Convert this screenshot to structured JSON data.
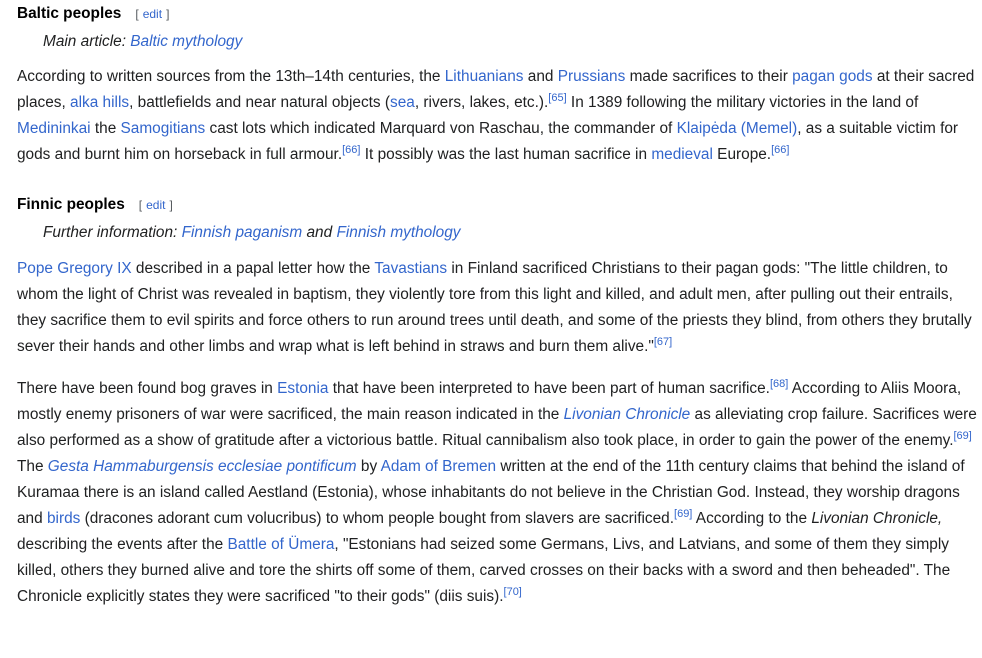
{
  "baltic": {
    "heading": "Baltic peoples",
    "edit_open": "[",
    "edit_label": "edit",
    "edit_close": "]",
    "hatnote_prefix": "Main article: ",
    "hatnote_link": "Baltic mythology",
    "p": [
      "According to written sources from the 13th–14th centuries, the ",
      "Lithuanians",
      " and ",
      "Prussians",
      " made sacrifices to their ",
      "pagan gods",
      " at their sacred places, ",
      "alka hills",
      ", battlefields and near natural objects (",
      "sea",
      ", rivers, lakes, etc.).",
      "[65]",
      " In 1389 following the military victories in the land of ",
      "Medininkai",
      " the ",
      "Samogitians",
      " cast lots which indicated Marquard von Raschau, the commander of ",
      "Klaipėda (Memel)",
      ", as a suitable victim for gods and burnt him on horseback in full armour.",
      "[66]",
      " It possibly was the last human sacrifice in ",
      "medieval",
      " Europe.",
      "[66]"
    ]
  },
  "finnic": {
    "heading": "Finnic peoples",
    "edit_open": "[",
    "edit_label": "edit",
    "edit_close": "]",
    "hatnote_prefix": "Further information: ",
    "hatnote_link1": "Finnish paganism",
    "hatnote_and": " and ",
    "hatnote_link2": "Finnish mythology",
    "p1": [
      "Pope Gregory IX",
      " described in a papal letter how the ",
      "Tavastians",
      " in Finland sacrificed Christians to their pagan gods: \"The little children, to whom the light of Christ was revealed in baptism, they violently tore from this light and killed, and adult men, after pulling out their entrails, they sacrifice them to evil spirits and force others to run around trees until death, and some of the priests they blind, from others they brutally sever their hands and other limbs and wrap what is left behind in straws and burn them alive.\"",
      "[67]"
    ],
    "p2": [
      "There have been found bog graves in ",
      "Estonia",
      " that have been interpreted to have been part of human sacrifice.",
      "[68]",
      " According to Aliis Moora, mostly enemy prisoners of war were sacrificed, the main reason indicated in the ",
      "Livonian Chronicle",
      " as alleviating crop failure. Sacrifices were also performed as a show of gratitude after a victorious battle. Ritual cannibalism also took place, in order to gain the power of the enemy.",
      "[69]",
      " The ",
      "Gesta Hammaburgensis ecclesiae pontificum",
      " by ",
      "Adam of Bremen",
      " written at the end of the 11th century claims that behind the island of Kuramaa there is an island called Aestland (Estonia), whose inhabitants do not believe in the Christian God. Instead, they worship dragons and ",
      "birds",
      " (dracones adorant cum volucribus) to whom people bought from slavers are sacrificed.",
      "[69]",
      " According to the ",
      "Livonian Chronicle,",
      " describing the events after the ",
      "Battle of Ümera",
      ", \"Estonians had seized some Germans, Livs, and Latvians, and some of them they simply killed, others they burned alive and tore the shirts off some of them, carved crosses on their backs with a sword and then beheaded\". The Chronicle explicitly states they were sacrificed \"to their gods\" (diis suis).",
      "[70]"
    ]
  }
}
